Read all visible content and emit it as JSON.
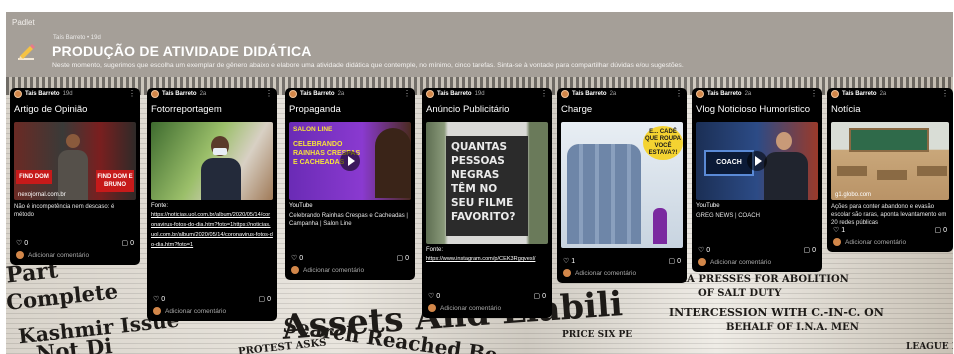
{
  "header": {
    "brand": "Padlet",
    "author_line": "Taís Barreto • 19d",
    "title": "PRODUÇÃO DE ATIVIDADE DIDÁTICA",
    "description": "Neste momento, sugerimos que escolha um exemplar de gênero abaixo e elabore uma atividade didática que contemple, no mínimo, cinco tarefas. Sinta-se à vontade para compartilhar dúvidas e/ou sugestões."
  },
  "background_text": {
    "w1": "Part",
    "w2": "Complete",
    "w3": "Kashmir Issue",
    "w4": "Not Di",
    "w5": "Assets And Liabili",
    "w6": "Search Reached Be",
    "w7": "PROTEST ASKS",
    "w8": "PRICE SIX PE",
    "w9": "HATMA PRESSES FOR ABOLITION",
    "w10": "OF SALT DUTY",
    "w11": "INTERCESSION WITH C.-IN-C. ON",
    "w12": "BEHALF OF I.N.A. MEN",
    "w13": "LEAGUE DE"
  },
  "columns": [
    {
      "author": "Taís Barreto",
      "time": "19d",
      "title": "Artigo de Opinião",
      "domain": "nexojornal.com.br",
      "caption": "Não é incompetência nem descaso: é método",
      "thumb_text_1": "FIND DOM",
      "thumb_text_2": "FIND DOM E BRUNO",
      "likes": "0",
      "comments": "0",
      "add_comment": "Adicionar comentário"
    },
    {
      "author": "Taís Barreto",
      "time": "2a",
      "title": "Fotorreportagem",
      "src_label": "Fonte:",
      "src_link": "https://noticias.uol.com.br/album/2020/05/14/coronavirus-fotos-do-dia.htm?foto=1https://noticias.uol.com.br/album/2020/05/14/coronavirus-fotos-do-dia.htm?foto=1",
      "likes": "0",
      "comments": "0",
      "add_comment": "Adicionar comentário"
    },
    {
      "author": "Taís Barreto",
      "time": "2a",
      "title": "Propaganda",
      "thumb_text_1": "SALON LINE",
      "thumb_text_2": "CELEBRANDO RAINHAS CRESPAS E CACHEADAS",
      "domain": "YouTube",
      "caption": "Celebrando Rainhas Crespas e Cacheadas | Campanha | Salon Line",
      "likes": "0",
      "comments": "0",
      "add_comment": "Adicionar comentário"
    },
    {
      "author": "Taís Barreto",
      "time": "19d",
      "title": "Anúncio Publicitário",
      "thumb_text": "QUANTAS PESSOAS NEGRAS TÊM NO SEU FILME FAVORITO?",
      "src_label": "Fonte:",
      "src_link": "https://www.instagram.com/p/CEK3Rgqvesl/",
      "likes": "0",
      "comments": "0",
      "add_comment": "Adicionar comentário"
    },
    {
      "author": "Taís Barreto",
      "time": "2a",
      "title": "Charge",
      "thumb_text": "E... CADÊ QUE ROUPA VOCÊ ESTAVA?!",
      "likes": "1",
      "comments": "0",
      "add_comment": "Adicionar comentário"
    },
    {
      "author": "Taís Barreto",
      "time": "2a",
      "title": "Vlog Noticioso Humorístico",
      "domain": "YouTube",
      "caption": "GREG NEWS | COACH",
      "thumb_text": "COACH",
      "likes": "0",
      "comments": "0",
      "add_comment": "Adicionar comentário"
    },
    {
      "author": "Taís Barreto",
      "time": "2a",
      "title": "Notícia",
      "domain": "g1.globo.com",
      "caption": "Ações para conter abandono e evasão escolar são raras, aponta levantamento em 20 redes públicas",
      "likes": "1",
      "comments": "0",
      "add_comment": "Adicionar comentário"
    }
  ],
  "colors": {
    "header_bg": "#a59f98",
    "card_bg": "#000000",
    "avatar": "#d2874a"
  }
}
